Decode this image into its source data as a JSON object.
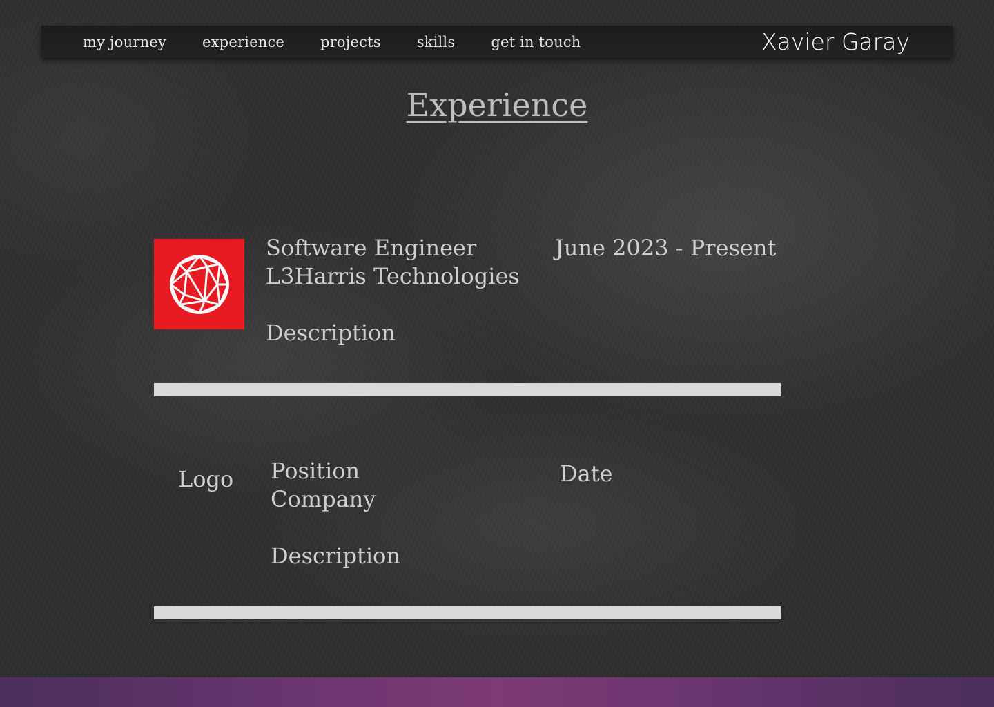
{
  "nav": {
    "links": [
      "my journey",
      "experience",
      "projects",
      "skills",
      "get in touch"
    ],
    "brand": "Xavier Garay"
  },
  "section": {
    "title": "Experience"
  },
  "entries": [
    {
      "logo_icon": "geodesic-sphere-icon",
      "logo_color": "#e91b22",
      "position": "Software Engineer",
      "company": "L3Harris Technologies",
      "date": "June 2023 - Present",
      "description": "Description"
    },
    {
      "logo_label": "Logo",
      "position": "Position",
      "company": "Company",
      "date": "Date",
      "description": "Description"
    }
  ],
  "colors": {
    "background": "#2f2f2f",
    "navbar": "#1c1c1c",
    "divider": "#d9d9d9",
    "footer_accent": "#7d3a74"
  }
}
